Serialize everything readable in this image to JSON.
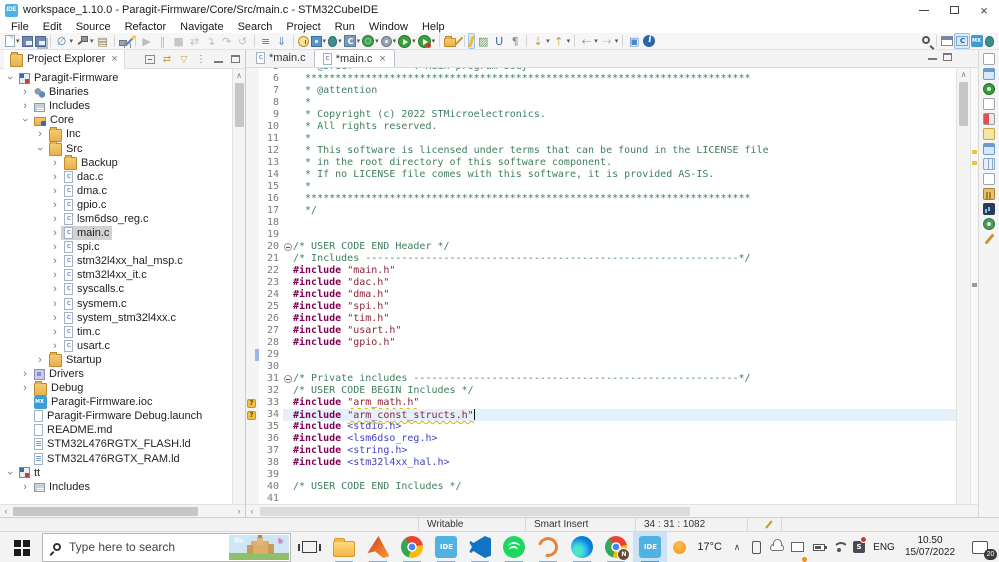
{
  "colors": {
    "accent_blue": "#4FB3E2",
    "keyword": "#7f0055",
    "comment": "#3f7f5f",
    "string": "#8b2438",
    "angle_include": "#4343c0",
    "warning": "#f0c040",
    "current_line": "#e4f0fb",
    "selection_gray": "#d2d2d2"
  },
  "window": {
    "title": "workspace_1.10.0 - Paragit-Firmware/Core/Src/main.c - STM32CubeIDE",
    "app_badge": "IDE"
  },
  "menu": [
    "File",
    "Edit",
    "Source",
    "Refactor",
    "Navigate",
    "Search",
    "Project",
    "Run",
    "Window",
    "Help"
  ],
  "toolbar": {
    "items": [
      {
        "name": "new-wizard-icon",
        "k": "page",
        "caret": true
      },
      {
        "name": "save-icon",
        "k": "floppy"
      },
      {
        "name": "save-all-icon",
        "k": "floppy2"
      },
      {
        "name": "skip-breakpoints-icon",
        "ch": "∅",
        "fg": "#4a7ab5",
        "caret": true,
        "sep": true
      },
      {
        "name": "build-icon",
        "k": "hammer",
        "caret": true
      },
      {
        "name": "build-all-icon",
        "ch": "▤",
        "fg": "#8a7a50"
      },
      {
        "name": "new-connection-icon",
        "k": "lock",
        "sep": true
      },
      {
        "name": "search-wand-icon",
        "k": "wand"
      },
      {
        "name": "resume-icon",
        "ch": "▶",
        "fg": "#bdbdbd",
        "sep": true
      },
      {
        "name": "suspend-icon",
        "ch": "‖",
        "fg": "#bdbdbd"
      },
      {
        "name": "terminate-icon",
        "ch": "■",
        "fg": "#c6c6c6"
      },
      {
        "name": "disconnect-icon",
        "ch": "⇄",
        "fg": "#bdbdbd"
      },
      {
        "name": "step-into-icon",
        "ch": "↴",
        "fg": "#bdbdbd"
      },
      {
        "name": "step-over-icon",
        "ch": "↷",
        "fg": "#bdbdbd"
      },
      {
        "name": "step-return-icon",
        "ch": "↺",
        "fg": "#bdbdbd"
      },
      {
        "name": "console-icon",
        "ch": "≡",
        "fg": "#5a7a9a",
        "sep": true
      },
      {
        "name": "flash-program-icon",
        "ch": "⇓",
        "fg": "#4c86c8"
      },
      {
        "name": "profile-icon",
        "k": "clock",
        "sep": true
      },
      {
        "name": "debug-board-icon",
        "k": "chip",
        "caret": true
      },
      {
        "name": "debug-icon",
        "k": "bug",
        "caret": true
      },
      {
        "name": "c-application-icon",
        "k": "ccube",
        "caret": true
      },
      {
        "name": "coverage-icon",
        "k": "globe",
        "caret": true
      },
      {
        "name": "external-tools-icon",
        "k": "gear",
        "caret": true
      },
      {
        "name": "run-icon",
        "k": "playg",
        "caret": true
      },
      {
        "name": "run-config-icon",
        "k": "playr",
        "caret": true
      },
      {
        "name": "open-resource-icon",
        "k": "folder",
        "sep": true
      },
      {
        "name": "annotate-icon",
        "k": "wand2"
      },
      {
        "name": "mark-occurrences-icon",
        "k": "bolt",
        "active": true,
        "sep": true
      },
      {
        "name": "write-occurrences-icon",
        "ch": "▨",
        "fg": "#6a9a5a"
      },
      {
        "name": "include-browser-icon",
        "ch": "U",
        "fg": "#3a6ac0"
      },
      {
        "name": "show-whitespace-icon",
        "ch": "¶",
        "fg": "#8a8a8a"
      },
      {
        "name": "last-edit-location-icon",
        "ch": "⇣",
        "fg": "#c09a3c",
        "caret": true,
        "sep": true
      },
      {
        "name": "next-edit-location-icon",
        "ch": "⇡",
        "fg": "#c09a3c",
        "caret": true
      },
      {
        "name": "back-icon",
        "ch": "⇠",
        "fg": "#c09a3c",
        "caret": true,
        "sep": true
      },
      {
        "name": "forward-icon",
        "ch": "⇢",
        "fg": "#bdbdbd",
        "caret": true
      },
      {
        "name": "new-editor-window-icon",
        "ch": "▣",
        "fg": "#4c86c8",
        "sep": true
      },
      {
        "name": "info-icon",
        "k": "info"
      }
    ],
    "right": [
      {
        "name": "quick-access-search-icon",
        "k": "search"
      },
      {
        "name": "open-perspective-icon",
        "k": "winp",
        "sep": true
      },
      {
        "name": "perspective-cpp-icon",
        "k": "cpp",
        "active": true
      },
      {
        "name": "perspective-deviceconfig-icon",
        "k": "mx"
      },
      {
        "name": "perspective-debug-icon",
        "k": "bug"
      }
    ]
  },
  "explorer": {
    "title": "Project Explorer",
    "header_icons": [
      "collapse-all-icon",
      "link-with-editor-icon",
      "filter-icon",
      "view-menu-icon",
      "minimize-view-icon",
      "maximize-view-icon"
    ],
    "items": [
      {
        "label": "Paragit-Firmware",
        "d": 0,
        "a": "e",
        "k": "proj"
      },
      {
        "label": "Binaries",
        "d": 1,
        "a": "c",
        "k": "bin"
      },
      {
        "label": "Includes",
        "d": 1,
        "a": "c",
        "k": "inc"
      },
      {
        "label": "Core",
        "d": 1,
        "a": "e",
        "k": "modf"
      },
      {
        "label": "Inc",
        "d": 2,
        "a": "c",
        "k": "folder"
      },
      {
        "label": "Src",
        "d": 2,
        "a": "e",
        "k": "folder"
      },
      {
        "label": "Backup",
        "d": 3,
        "a": "c",
        "k": "folder"
      },
      {
        "label": "dac.c",
        "d": 3,
        "a": "c",
        "k": "cfile"
      },
      {
        "label": "dma.c",
        "d": 3,
        "a": "c",
        "k": "cfile"
      },
      {
        "label": "gpio.c",
        "d": 3,
        "a": "c",
        "k": "cfile"
      },
      {
        "label": "lsm6dso_reg.c",
        "d": 3,
        "a": "c",
        "k": "cfile"
      },
      {
        "label": "main.c",
        "d": 3,
        "a": "c",
        "k": "cfile",
        "sel": true
      },
      {
        "label": "spi.c",
        "d": 3,
        "a": "c",
        "k": "cfile"
      },
      {
        "label": "stm32l4xx_hal_msp.c",
        "d": 3,
        "a": "c",
        "k": "cfile"
      },
      {
        "label": "stm32l4xx_it.c",
        "d": 3,
        "a": "c",
        "k": "cfile"
      },
      {
        "label": "syscalls.c",
        "d": 3,
        "a": "c",
        "k": "cfile"
      },
      {
        "label": "sysmem.c",
        "d": 3,
        "a": "c",
        "k": "cfile"
      },
      {
        "label": "system_stm32l4xx.c",
        "d": 3,
        "a": "c",
        "k": "cfile"
      },
      {
        "label": "tim.c",
        "d": 3,
        "a": "c",
        "k": "cfile"
      },
      {
        "label": "usart.c",
        "d": 3,
        "a": "c",
        "k": "cfile"
      },
      {
        "label": "Startup",
        "d": 2,
        "a": "c",
        "k": "folder"
      },
      {
        "label": "Drivers",
        "d": 1,
        "a": "c",
        "k": "drv"
      },
      {
        "label": "Debug",
        "d": 1,
        "a": "c",
        "k": "folder"
      },
      {
        "label": "Paragit-Firmware.ioc",
        "d": 1,
        "a": "n",
        "k": "mx"
      },
      {
        "label": "Paragit-Firmware Debug.launch",
        "d": 1,
        "a": "n",
        "k": "file"
      },
      {
        "label": "README.md",
        "d": 1,
        "a": "n",
        "k": "file"
      },
      {
        "label": "STM32L476RGTX_FLASH.ld",
        "d": 1,
        "a": "n",
        "k": "ld"
      },
      {
        "label": "STM32L476RGTX_RAM.ld",
        "d": 1,
        "a": "n",
        "k": "ld"
      },
      {
        "label": "tt",
        "d": 0,
        "a": "e",
        "k": "proj"
      },
      {
        "label": "Includes",
        "d": 1,
        "a": "c",
        "k": "inc"
      }
    ]
  },
  "editor": {
    "tabs": [
      {
        "label": "*main.c",
        "active": false
      },
      {
        "label": "*main.c",
        "active": true
      }
    ],
    "lines": [
      {
        "n": 5,
        "segs": [
          [
            "c",
            "  * @brief          : Main program body"
          ]
        ]
      },
      {
        "n": 6,
        "segs": [
          [
            "c",
            "  **************************************************************************"
          ]
        ]
      },
      {
        "n": 7,
        "segs": [
          [
            "c",
            "  * @attention"
          ]
        ]
      },
      {
        "n": 8,
        "segs": [
          [
            "c",
            "  *"
          ]
        ]
      },
      {
        "n": 9,
        "segs": [
          [
            "c",
            "  * Copyright (c) 2022 STMicroelectronics."
          ]
        ]
      },
      {
        "n": 10,
        "segs": [
          [
            "c",
            "  * All rights reserved."
          ]
        ]
      },
      {
        "n": 11,
        "segs": [
          [
            "c",
            "  *"
          ]
        ]
      },
      {
        "n": 12,
        "segs": [
          [
            "c",
            "  * This software is licensed under terms that can be found in the LICENSE file"
          ]
        ]
      },
      {
        "n": 13,
        "segs": [
          [
            "c",
            "  * in the root directory of this software component."
          ]
        ]
      },
      {
        "n": 14,
        "segs": [
          [
            "c",
            "  * If no LICENSE file comes with this software, it is provided AS-IS."
          ]
        ]
      },
      {
        "n": 15,
        "segs": [
          [
            "c",
            "  *"
          ]
        ]
      },
      {
        "n": 16,
        "segs": [
          [
            "c",
            "  **************************************************************************"
          ]
        ]
      },
      {
        "n": 17,
        "segs": [
          [
            "c",
            "  */"
          ]
        ]
      },
      {
        "n": 18,
        "segs": []
      },
      {
        "n": 19,
        "segs": []
      },
      {
        "n": 20,
        "fold": true,
        "segs": [
          [
            "c",
            "/* USER CODE END Header */"
          ]
        ]
      },
      {
        "n": 21,
        "segs": [
          [
            "c",
            "/* Includes --------------------------------------------------------------*/"
          ]
        ]
      },
      {
        "n": 22,
        "segs": [
          [
            "d",
            "#include"
          ],
          [
            "p",
            " "
          ],
          [
            "s",
            "\"main.h\""
          ]
        ]
      },
      {
        "n": 23,
        "segs": [
          [
            "d",
            "#include"
          ],
          [
            "p",
            " "
          ],
          [
            "s",
            "\"dac.h\""
          ]
        ]
      },
      {
        "n": 24,
        "segs": [
          [
            "d",
            "#include"
          ],
          [
            "p",
            " "
          ],
          [
            "s",
            "\"dma.h\""
          ]
        ]
      },
      {
        "n": 25,
        "segs": [
          [
            "d",
            "#include"
          ],
          [
            "p",
            " "
          ],
          [
            "s",
            "\"spi.h\""
          ]
        ]
      },
      {
        "n": 26,
        "segs": [
          [
            "d",
            "#include"
          ],
          [
            "p",
            " "
          ],
          [
            "s",
            "\"tim.h\""
          ]
        ]
      },
      {
        "n": 27,
        "segs": [
          [
            "d",
            "#include"
          ],
          [
            "p",
            " "
          ],
          [
            "s",
            "\"usart.h\""
          ]
        ]
      },
      {
        "n": 28,
        "segs": [
          [
            "d",
            "#include"
          ],
          [
            "p",
            " "
          ],
          [
            "s",
            "\"gpio.h\""
          ]
        ]
      },
      {
        "n": 29,
        "diff": true,
        "segs": []
      },
      {
        "n": 30,
        "segs": []
      },
      {
        "n": 31,
        "fold": true,
        "segs": [
          [
            "c",
            "/* Private includes ------------------------------------------------------*/"
          ]
        ]
      },
      {
        "n": 32,
        "segs": [
          [
            "c",
            "/* USER CODE BEGIN Includes */"
          ]
        ]
      },
      {
        "n": 33,
        "mk": "warn",
        "segs": [
          [
            "d",
            "#include"
          ],
          [
            "p",
            " "
          ],
          [
            "w",
            "\"arm_math.h\""
          ]
        ]
      },
      {
        "n": 34,
        "mk": "warn",
        "cur": true,
        "caret": true,
        "segs": [
          [
            "d",
            "#include"
          ],
          [
            "p",
            " "
          ],
          [
            "w",
            "\"arm_const_structs.h\""
          ]
        ]
      },
      {
        "n": 35,
        "segs": [
          [
            "d",
            "#include"
          ],
          [
            "p",
            " "
          ],
          [
            "a",
            "<stdio.h>"
          ]
        ]
      },
      {
        "n": 36,
        "segs": [
          [
            "d",
            "#include"
          ],
          [
            "p",
            " "
          ],
          [
            "a",
            "<lsm6dso_reg.h>"
          ]
        ]
      },
      {
        "n": 37,
        "segs": [
          [
            "d",
            "#include"
          ],
          [
            "p",
            " "
          ],
          [
            "a",
            "<string.h>"
          ]
        ]
      },
      {
        "n": 38,
        "segs": [
          [
            "d",
            "#include"
          ],
          [
            "p",
            " "
          ],
          [
            "a",
            "<stm32l4xx_hal.h>"
          ]
        ]
      },
      {
        "n": 39,
        "segs": []
      },
      {
        "n": 40,
        "segs": [
          [
            "c",
            "/* USER CODE END Includes */"
          ]
        ]
      },
      {
        "n": 41,
        "segs": []
      }
    ]
  },
  "strip": [
    "sk-page",
    "sk-win",
    "sk-target",
    "sk-page",
    "sk-chip",
    "sk-note",
    "sk-win",
    "sk-grid",
    "sk-page",
    "sk-bldg",
    "sk-chart",
    "sk-gear",
    "sk-pen"
  ],
  "statusbar": {
    "writable": "Writable",
    "insert_mode": "Smart Insert",
    "position": "34 : 31 : 1082"
  },
  "taskbar": {
    "search_placeholder": "Type here to search",
    "apps": [
      {
        "name": "file-explorer-icon",
        "k": "tk-folder"
      },
      {
        "name": "matlab-icon",
        "k": "tk-matlab"
      },
      {
        "name": "chrome-icon",
        "k": "tk-chrome"
      },
      {
        "name": "cubeide-icon",
        "k": "tk-ide"
      },
      {
        "name": "vscode-icon",
        "k": "tk-vscode"
      },
      {
        "name": "spotify-icon",
        "k": "tk-spotify"
      },
      {
        "name": "arc-app-icon",
        "k": "tk-arc"
      },
      {
        "name": "edge-icon",
        "k": "tk-edge"
      },
      {
        "name": "chrome-profile-icon",
        "k": "tk-chromeN"
      },
      {
        "name": "cubeide-active-icon",
        "k": "tk-ide",
        "active": true
      }
    ],
    "tray": {
      "temperature": "17°C",
      "language": "ENG",
      "time": "10.50",
      "date": "15/07/2022",
      "notification_count": "20",
      "icons": [
        "weather-icon",
        "hidden-icons-chevron",
        "phone-link-icon",
        "onedrive-icon",
        "screenshot-icon",
        "battery-icon",
        "wifi-icon",
        "messaging-icon"
      ]
    }
  }
}
